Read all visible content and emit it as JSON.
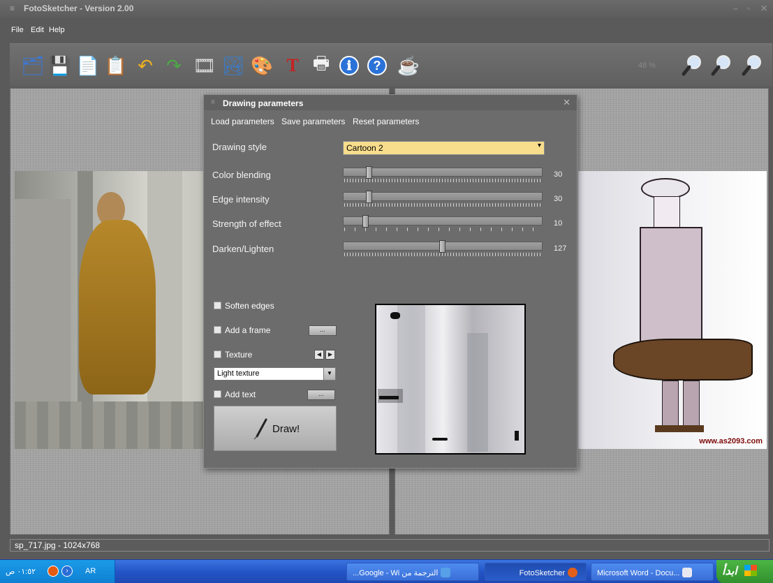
{
  "window": {
    "title": "FotoSketcher - Version 2.00",
    "sysmenu_glyph": "≡",
    "min_glyph": "–",
    "max_glyph": "▫",
    "close_glyph": "✕"
  },
  "menu": {
    "items": [
      "File",
      "Edit",
      "Help"
    ]
  },
  "toolbar": {
    "icons": [
      "open-folder-icon",
      "save-disk-icon",
      "copy-icon",
      "paste-icon",
      "undo-icon",
      "redo-icon",
      "filmstrip-icon",
      "landscape-icon",
      "paint-palette-icon",
      "text-tool-icon",
      "printer-icon",
      "info-icon",
      "help-icon",
      "coffee-cup-icon"
    ],
    "glyphs": [
      "🗂",
      "💾",
      "📄",
      "📋",
      "↶",
      "↷",
      "🎞",
      "🏞",
      "🎨",
      "T",
      "🖶",
      "ℹ",
      "?",
      "☕"
    ],
    "colors": [
      "#3a78d6",
      "#444444",
      "#dddddd",
      "#b47a35",
      "#f0b020",
      "#4caa45",
      "#dcdcdc",
      "#3d7bc5",
      "#d98c2b",
      "#c42323",
      "#f2f2f2",
      "#2a72d8",
      "#2a72d8",
      "#eeeeee"
    ],
    "zoom_level": "48 %",
    "zoom_icons": [
      "zoom-fit-icon",
      "zoom-actual-icon",
      "zoom-in-icon"
    ]
  },
  "status": {
    "file_info": "sp_717.jpg - 1024x768"
  },
  "taskbar": {
    "clock": "٠١:٥٢ ص",
    "lang": "AR",
    "tasks": [
      {
        "label": "...Google - Wi الترجمة من",
        "active": false
      },
      {
        "label": "FotoSketcher",
        "active": true
      },
      {
        "label": "Microsoft Word - Docu...",
        "active": false
      }
    ],
    "start_label": "ابدأ"
  },
  "dialog": {
    "title": "Drawing parameters",
    "links": [
      "Load parameters",
      "Save parameters",
      "Reset parameters"
    ],
    "drawing_style": {
      "label": "Drawing style",
      "value": "Cartoon 2"
    },
    "sliders": [
      {
        "label": "Color blending",
        "value": 30,
        "max": 255,
        "fraction": 0.118
      },
      {
        "label": "Edge intensity",
        "value": 30,
        "max": 255,
        "fraction": 0.118
      },
      {
        "label": "Strength of effect",
        "value": 10,
        "max": 100,
        "fraction": 0.1
      },
      {
        "label": "Darken/Lighten",
        "value": 127,
        "max": 255,
        "fraction": 0.498
      }
    ],
    "options": {
      "soften_edges": "Soften edges",
      "add_frame": "Add a frame",
      "texture": "Texture",
      "texture_value": "Light texture",
      "add_text": "Add text",
      "browse_label": "...",
      "prev_glyph": "◀",
      "next_glyph": "▶"
    },
    "draw_button": "Draw!"
  },
  "photo": {
    "watermark": "www.as2093.com"
  }
}
